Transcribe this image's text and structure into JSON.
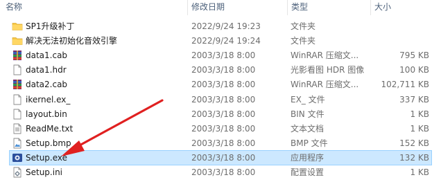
{
  "columns": {
    "name": "名称",
    "date": "修改日期",
    "type": "类型",
    "size": "大小"
  },
  "files": [
    {
      "name": "SP1升级补丁",
      "date": "2022/9/24 19:23",
      "type": "文件夹",
      "size": "",
      "icon": "folder-icon"
    },
    {
      "name": "解决无法初始化音效引擎",
      "date": "2022/9/24 19:24",
      "type": "文件夹",
      "size": "",
      "icon": "folder-icon"
    },
    {
      "name": "data1.cab",
      "date": "2003/3/18 8:00",
      "type": "WinRAR 压缩文...",
      "size": "795 KB",
      "icon": "winrar-archive-icon"
    },
    {
      "name": "data1.hdr",
      "date": "2003/3/18 8:00",
      "type": "光影看图 HDR 图像",
      "size": "100 KB",
      "icon": "file-icon"
    },
    {
      "name": "data2.cab",
      "date": "2003/3/18 8:00",
      "type": "WinRAR 压缩文...",
      "size": "102,711 KB",
      "icon": "winrar-archive-icon"
    },
    {
      "name": "ikernel.ex_",
      "date": "2003/3/18 8:00",
      "type": "EX_ 文件",
      "size": "337 KB",
      "icon": "file-icon"
    },
    {
      "name": "layout.bin",
      "date": "2003/3/18 8:00",
      "type": "BIN 文件",
      "size": "1 KB",
      "icon": "file-icon"
    },
    {
      "name": "ReadMe.txt",
      "date": "2003/3/18 8:00",
      "type": "文本文档",
      "size": "1 KB",
      "icon": "text-file-icon"
    },
    {
      "name": "Setup.bmp",
      "date": "2003/3/18 8:00",
      "type": "BMP 文件",
      "size": "152 KB",
      "icon": "image-file-icon"
    },
    {
      "name": "Setup.exe",
      "date": "2003/3/18 8:00",
      "type": "应用程序",
      "size": "132 KB",
      "icon": "setup-exe-icon",
      "selected": true
    },
    {
      "name": "Setup.ini",
      "date": "2003/3/18 8:00",
      "type": "配置设置",
      "size": "1 KB",
      "icon": "config-file-icon"
    }
  ],
  "colors": {
    "selection": "#cce8ff",
    "selection_border": "#99d1ff",
    "annotation_arrow": "#e02020",
    "folder": "#f8c948"
  }
}
